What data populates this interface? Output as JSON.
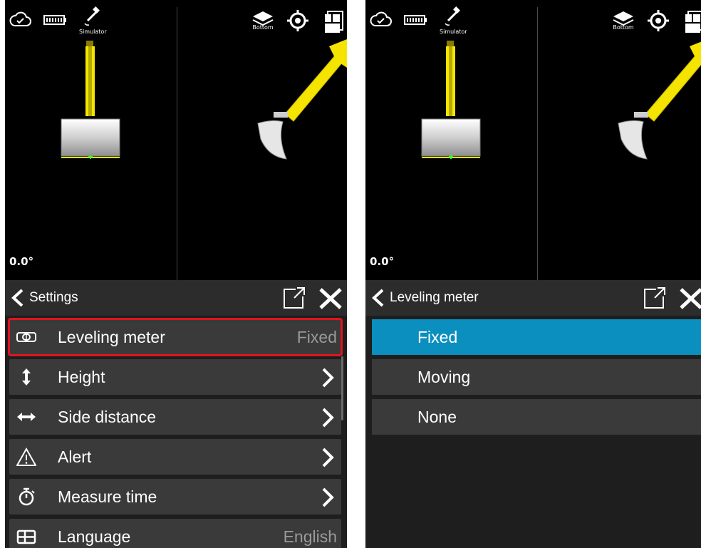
{
  "left_screen": {
    "status": {
      "simulator_label": "Simulator",
      "bottom_label": "Bottom"
    },
    "angle_readout": "0.0°",
    "header": {
      "title": "Settings"
    },
    "settings_items": [
      {
        "label": "Leveling meter",
        "value": "Fixed",
        "icon": "level-icon",
        "highlighted": true
      },
      {
        "label": "Height",
        "icon": "vertical-arrows-icon"
      },
      {
        "label": "Side distance",
        "icon": "horizontal-arrows-icon"
      },
      {
        "label": "Alert",
        "icon": "warning-icon"
      },
      {
        "label": "Measure time",
        "icon": "stopwatch-icon"
      },
      {
        "label": "Language",
        "value": "English",
        "icon": "language-icon"
      }
    ]
  },
  "right_screen": {
    "status": {
      "simulator_label": "Simulator",
      "bottom_label": "Bottom"
    },
    "angle_readout": "0.0°",
    "header": {
      "title": "Leveling meter"
    },
    "options": [
      {
        "label": "Fixed",
        "selected": true
      },
      {
        "label": "Moving",
        "selected": false
      },
      {
        "label": "None",
        "selected": false
      }
    ]
  },
  "colors": {
    "accent_selected": "#0a8fbf",
    "highlight_outline": "#e0141e",
    "boom_yellow": "#f5e400",
    "panel_bg": "#3a3a3a"
  }
}
